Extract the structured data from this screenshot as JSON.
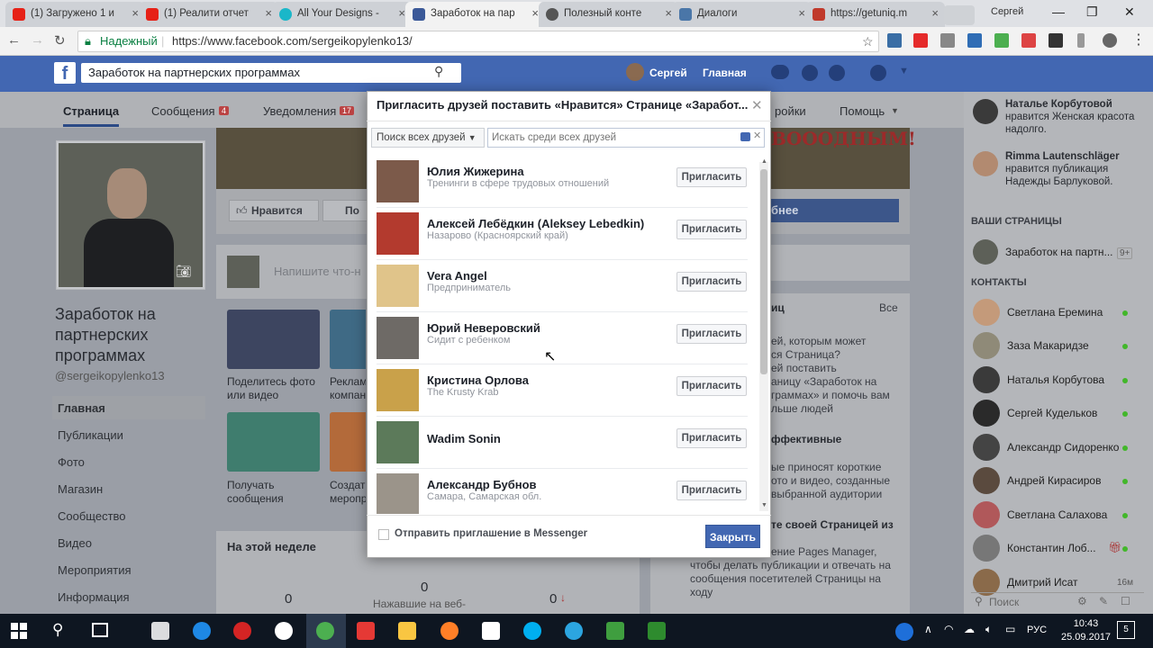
{
  "browser": {
    "tabs": [
      {
        "title": "(1) Загружено 1 и",
        "color": "#e62117"
      },
      {
        "title": "(1) Реалити отчет",
        "color": "#e62117"
      },
      {
        "title": "All Your Designs -",
        "color": "#1ab7c9"
      },
      {
        "title": "Заработок на пар",
        "color": "#3b5998"
      },
      {
        "title": "Полезный конте",
        "color": "#555555"
      },
      {
        "title": "Диалоги",
        "color": "#4a76a8"
      },
      {
        "title": "https://getuniq.m",
        "color": "#c0392b"
      }
    ],
    "user": "Сергей",
    "secure_label": "Надежный",
    "url": "https://www.facebook.com/sergeikopylenko13/"
  },
  "fb_header": {
    "search_value": "Заработок на партнерских программах",
    "user_name": "Сергей",
    "home": "Главная"
  },
  "page_tabs": {
    "page": "Страница",
    "messages": "Сообщения",
    "messages_count": "4",
    "notifications": "Уведомления",
    "notifications_count": "17",
    "settings_partial": "ройки",
    "help": "Помощь"
  },
  "profile": {
    "name": "Заработок на партнерских программах",
    "handle": "@sergeikopylenko13",
    "nav": [
      "Главная",
      "Публикации",
      "Фото",
      "Магазин",
      "Сообщество",
      "Видео",
      "Мероприятия",
      "Информация"
    ]
  },
  "background": {
    "like_btn": "Нравится",
    "follow_partial": "По",
    "write_placeholder": "Напишите что-н",
    "share_photo": "Поделитесь фото или видео",
    "ad_partial": "Реклам компан",
    "get_messages": "Получать сообщения",
    "create_partial": "Создать меропр",
    "this_week": "На этой неделе",
    "stat1_value": "0",
    "stat2_value": "0",
    "stat2_label": "Нажавшие на веб-",
    "stat3_value": "0",
    "cover_text": "ВОООДНЫМ!",
    "more_btn": "бнее",
    "panel_label_partial": "иц",
    "panel_all": "Все",
    "panel_lines": [
      "ей, которым может",
      "ся Страница?",
      "ей поставить",
      "аницу «Заработок на",
      "граммах» и помочь вам",
      "льше людей"
    ],
    "effective_partial": "ффективные",
    "panel_lines2": [
      "ые приносят короткие",
      "ото и видео, созданные",
      "выбранной аудитории"
    ],
    "manage_partial": "те своей Страницей из",
    "panel_lines3": [
      "ение Pages Manager,",
      "чтобы делать публикации и отвечать на",
      "сообщения посетителей Страницы на",
      "ходу"
    ]
  },
  "modal": {
    "title": "Пригласить друзей поставить «Нравится» Странице «Заработ...",
    "filter_label": "Поиск всех друзей",
    "search_placeholder": "Искать среди всех друзей",
    "invite_label": "Пригласить",
    "friends": [
      {
        "name": "Юлия Жижерина",
        "sub": "Тренинги в сфере трудовых отношений",
        "color": "#7c5a4a"
      },
      {
        "name": "Алексей Лебёдкин (Aleksey Lebedkin)",
        "sub": "Назарово (Красноярский край)",
        "color": "#b33a2e"
      },
      {
        "name": "Vera Angel",
        "sub": "Предприниматель",
        "color": "#e0c48a"
      },
      {
        "name": "Юрий Неверовский",
        "sub": "Сидит с ребенком",
        "color": "#6e6a66"
      },
      {
        "name": "Кристина Орлова",
        "sub": "The Krusty Krab",
        "color": "#c9a14a"
      },
      {
        "name": "Wadim Sonin",
        "sub": "",
        "color": "#5c7a5a"
      },
      {
        "name": "Александр Бубнов",
        "sub": "Самара, Самарская обл.",
        "color": "#9b948a"
      }
    ],
    "messenger_checkbox": "Отправить приглашение в Messenger",
    "close_label": "Закрыть"
  },
  "right_sidebar": {
    "notifications": [
      {
        "name": "Наталье Корбутовой",
        "text": "нравится Женская красота надолго."
      },
      {
        "name": "Rimma Lautenschläger",
        "text": "нравится публикация Надежды Барлуковой."
      }
    ],
    "your_pages_title": "ВАШИ СТРАНИЦЫ",
    "your_page_name": "Заработок на партн...",
    "your_page_badge": "9+",
    "contacts_title": "КОНТАКТЫ",
    "contacts": [
      {
        "name": "Светлана Еремина",
        "color": "#c49a7a"
      },
      {
        "name": "Заза Макаридзе",
        "color": "#8f8a78"
      },
      {
        "name": "Наталья Корбутова",
        "color": "#3a3a3a"
      },
      {
        "name": "Сергей Кудельков",
        "color": "#2a2a2a"
      },
      {
        "name": "Александр Сидоренко",
        "color": "#444444"
      },
      {
        "name": "Андрей Кирасиров",
        "color": "#5a4a3e"
      },
      {
        "name": "Светлана Салахова",
        "color": "#b0585a"
      },
      {
        "name": "Константин Лоб...",
        "color": "#777777"
      },
      {
        "name": "Дмитрий Исат",
        "color": "#8a6a4a"
      }
    ],
    "last_time": "16м",
    "search_placeholder": "Поиск"
  },
  "taskbar": {
    "lang": "РУС",
    "time": "10:43",
    "date": "25.09.2017",
    "notif_count": "5"
  }
}
